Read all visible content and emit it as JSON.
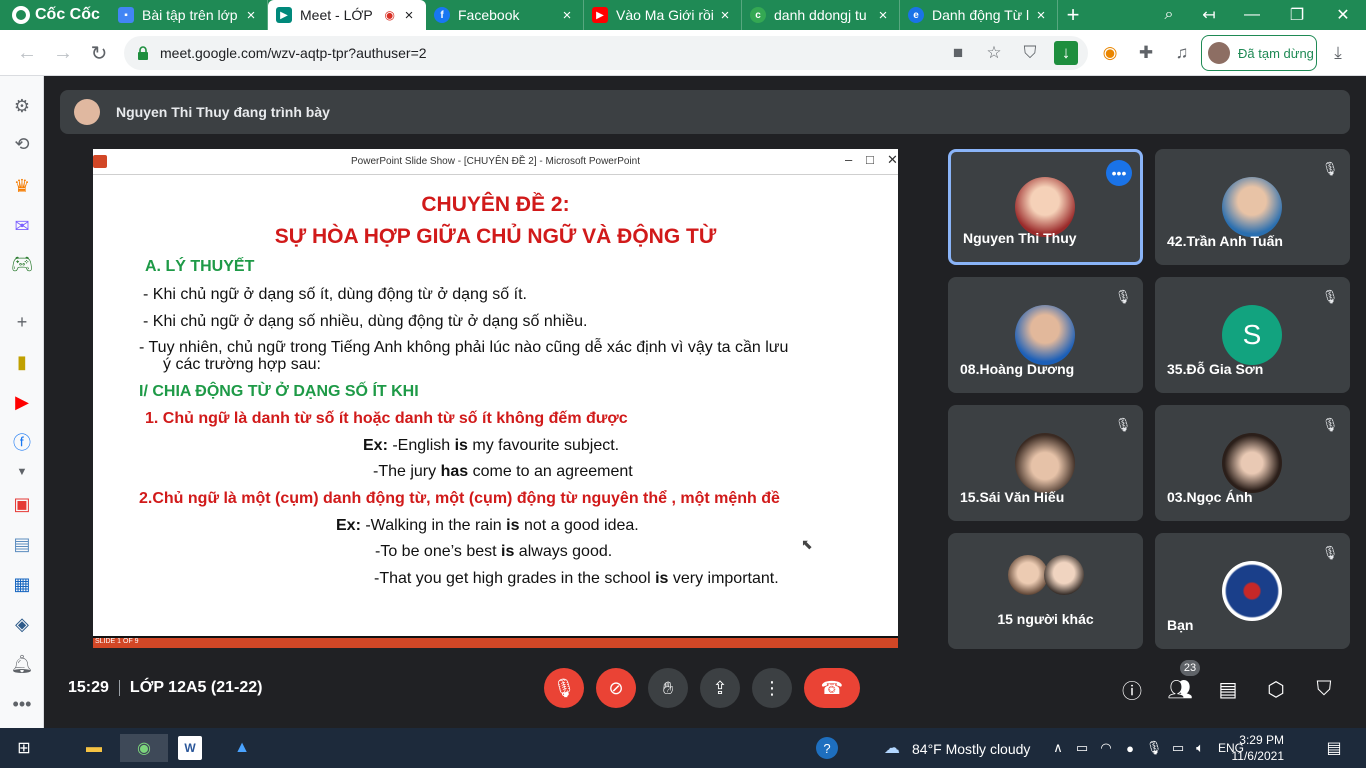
{
  "browser": {
    "brand": "Cốc Cốc",
    "tabs": [
      {
        "title": "Bài tập trên lớp",
        "icon": "classroom-icon",
        "color": "#4285f4"
      },
      {
        "title": "Meet - LỚP",
        "icon": "meet-icon",
        "color": "#00897b"
      },
      {
        "title": "Facebook",
        "icon": "facebook-icon",
        "color": "#1877f2"
      },
      {
        "title": "Vào Ma Giới rồi",
        "icon": "youtube-icon",
        "color": "#ff0000"
      },
      {
        "title": "danh ddongj tu",
        "icon": "coccoc-icon",
        "color": "#34a853"
      },
      {
        "title": "Danh động Từ l",
        "icon": "web-icon",
        "color": "#1a73e8"
      }
    ],
    "url": "meet.google.com/wzv-aqtp-tpr?authuser=2",
    "profile_label": "Đã tạm dừng"
  },
  "meet": {
    "presenter_banner": "Nguyen Thi Thuy đang trình bày",
    "time": "15:29",
    "meeting_name": "LỚP 12A5 (21-22)",
    "participant_count": "23",
    "participants": [
      {
        "name": "Nguyen Thi Thuy",
        "speaking": true
      },
      {
        "name": "42.Trần Anh Tuấn"
      },
      {
        "name": "08.Hoàng Dương"
      },
      {
        "name": "35.Đỗ Gia Sơn",
        "initial": "S"
      },
      {
        "name": "15.Sái Văn Hiếu"
      },
      {
        "name": "03.Ngọc Ánh"
      },
      {
        "name": "15 người khác"
      },
      {
        "name": "Bạn"
      }
    ]
  },
  "slide": {
    "window_title": "PowerPoint Slide Show - [CHUYÊN ĐỀ 2] - Microsoft PowerPoint",
    "title1": "CHUYÊN  ĐỀ 2:",
    "title2": "SỰ HÒA HỢP GIỮA CHỦ NGỮ VÀ ĐỘNG TỪ",
    "section_a": "A. LÝ THUYẾT",
    "bullet1": "- Khi chủ ngữ ở dạng số ít, dùng động từ ở dạng số ít.",
    "bullet2": "- Khi chủ ngữ ở dạng số nhiều, dùng động từ ở dạng số nhiều.",
    "bullet3a": "-    Tuy nhiên, chủ ngữ trong Tiếng Anh không phải lúc nào cũng dễ xác định  vì vậy ta cần lưu",
    "bullet3b": "ý các trường hợp sau:",
    "section_i": "I/ CHIA ĐỘNG TỪ Ở DẠNG SỐ ÍT KHI",
    "rule1": "1. Chủ ngữ là danh từ số ít hoặc danh từ số ít không đếm được",
    "ex1_label": "Ex:",
    "ex1_pre": " -English ",
    "ex1_verb": "is",
    "ex1_post": " my favourite subject.",
    "ex2_pre": "-The jury ",
    "ex2_verb": "has",
    "ex2_post": " come to an agreement",
    "rule2": "2.Chủ ngữ là một (cụm) danh động từ, một (cụm) động từ nguyên thể , một mệnh đề",
    "ex3_label": "Ex:",
    "ex3_pre": " -Walking in the rain ",
    "ex3_verb": "is",
    "ex3_post": " not a good idea.",
    "ex4_pre": "-To be one’s best ",
    "ex4_verb": "is",
    "ex4_post": " always good.",
    "ex5_pre": "-That you get high grades in the school ",
    "ex5_verb": "is",
    "ex5_post": " very important.",
    "status": "SLIDE 1 OF 9"
  },
  "taskbar": {
    "weather": "84°F  Mostly cloudy",
    "language": "ENG",
    "time": "3:29 PM",
    "date": "11/6/2021"
  }
}
